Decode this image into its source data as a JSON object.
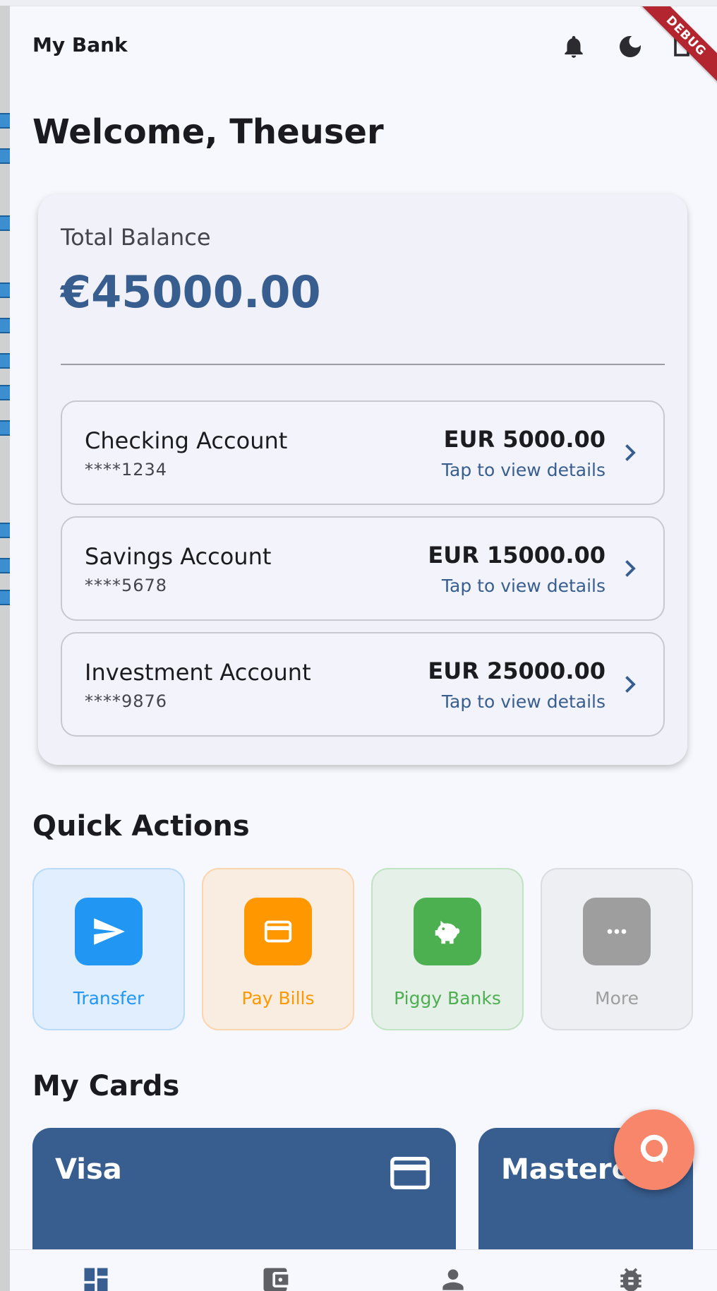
{
  "app": {
    "title": "My Bank",
    "debug_banner": "DEBUG"
  },
  "welcome": "Welcome, Theuser",
  "balance": {
    "label": "Total Balance",
    "amount": "€45000.00"
  },
  "accounts": [
    {
      "name": "Checking Account",
      "number": "****1234",
      "balance": "EUR 5000.00",
      "cta": "Tap to view details"
    },
    {
      "name": "Savings Account",
      "number": "****5678",
      "balance": "EUR 15000.00",
      "cta": "Tap to view details"
    },
    {
      "name": "Investment Account",
      "number": "****9876",
      "balance": "EUR 25000.00",
      "cta": "Tap to view details"
    }
  ],
  "quick_actions": {
    "title": "Quick Actions",
    "items": [
      {
        "label": "Transfer",
        "icon": "send-icon",
        "color": "#2196f3"
      },
      {
        "label": "Pay Bills",
        "icon": "credit-card-icon",
        "color": "#ff9800"
      },
      {
        "label": "Piggy Banks",
        "icon": "piggy-bank-icon",
        "color": "#4caf50"
      },
      {
        "label": "More",
        "icon": "more-horizontal-icon",
        "color": "#9e9e9e"
      }
    ]
  },
  "cards": {
    "title": "My Cards",
    "items": [
      {
        "name": "Visa"
      },
      {
        "name": "Masterc"
      }
    ]
  },
  "colors": {
    "primary": "#385e8f",
    "background": "#f7f8fd",
    "fab": "#f8866a",
    "debug": "#b3262f"
  },
  "nav": [
    {
      "icon": "dashboard-icon"
    },
    {
      "icon": "wallet-icon"
    },
    {
      "icon": "person-icon"
    },
    {
      "icon": "bug-icon"
    }
  ]
}
